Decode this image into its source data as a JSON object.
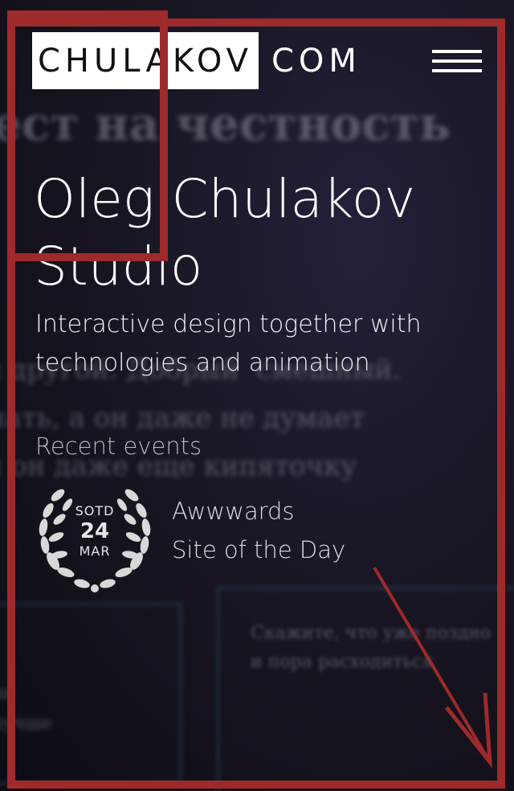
{
  "header": {
    "logo_boxed": "CHULAKOV",
    "logo_tail": "COM"
  },
  "hero": {
    "title": "Oleg Chulakov Studio",
    "subtitle": "Interactive design together with technologies and animation"
  },
  "events": {
    "label": "Recent events",
    "award": {
      "badge_top": "SOTD",
      "badge_day": "24",
      "badge_month": "MAR",
      "name_line1": "Awwwards",
      "name_line2": "Site of the Day"
    }
  },
  "icons": {
    "menu": "hamburger-icon",
    "laurel": "laurel-wreath-icon"
  },
  "colors": {
    "background": "#14121c",
    "annotation": "#9e2a2b",
    "logo_box": "#ffffff"
  }
}
